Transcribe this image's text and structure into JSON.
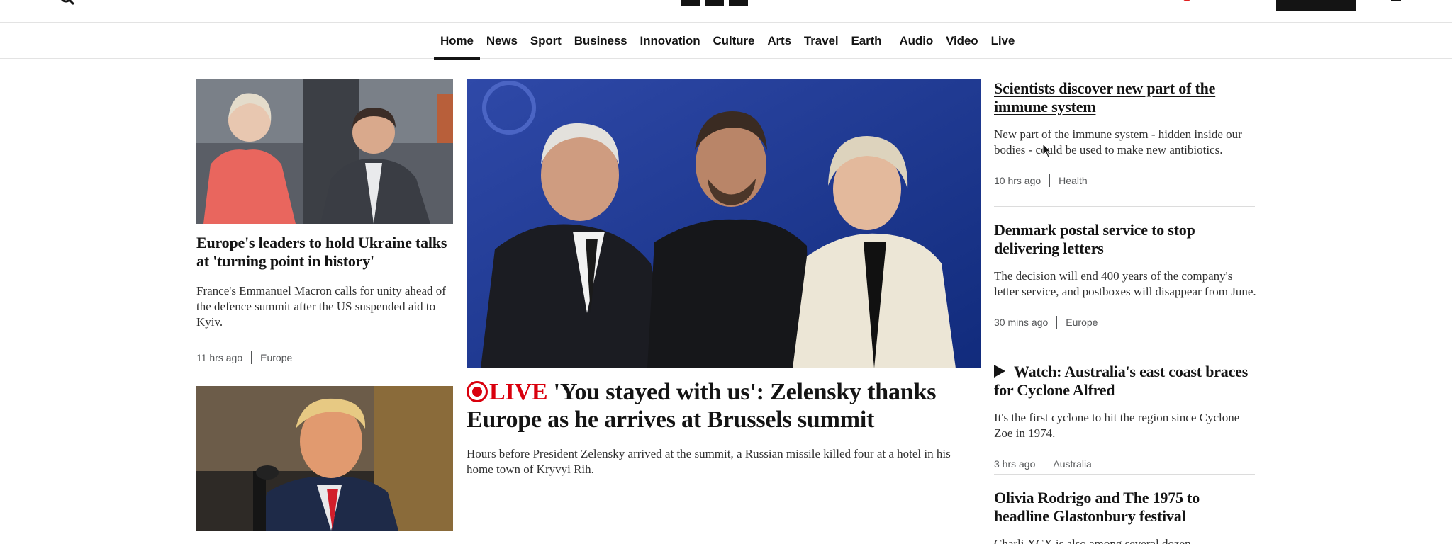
{
  "header": {
    "menu_icon": "hamburger-menu-icon",
    "search_icon": "search-icon",
    "logo": "bbc-logo"
  },
  "nav": {
    "items": [
      "Home",
      "News",
      "Sport",
      "Business",
      "Innovation",
      "Culture",
      "Arts",
      "Travel",
      "Earth",
      "Audio",
      "Video",
      "Live"
    ],
    "active": "Home"
  },
  "stories": {
    "europe_leaders": {
      "headline": "Europe's leaders to hold Ukraine talks at 'turning point in history'",
      "summary": "France's Emmanuel Macron calls for unity ahead of the defence summit after the US suspended aid to Kyiv.",
      "time": "11 hrs ago",
      "category": "Europe"
    },
    "zelensky_live": {
      "live_label": "LIVE",
      "headline": "'You stayed with us': Zelensky thanks Europe as he arrives at Brussels summit",
      "summary": "Hours before President Zelensky arrived at the summit, a Russian missile killed four at a hotel in his home town of Kryvyi Rih."
    },
    "immune_system": {
      "headline": "Scientists discover new part of the immune system",
      "summary": "New part of the immune system - hidden inside our bodies - could be used to make new antibiotics.",
      "time": "10 hrs ago",
      "category": "Health"
    },
    "denmark_post": {
      "headline": "Denmark postal service to stop delivering letters",
      "summary": "The decision will end 400 years of the company's letter service, and postboxes will disappear from June.",
      "time": "30 mins ago",
      "category": "Europe"
    },
    "cyclone_alfred": {
      "headline": "Watch: Australia's east coast braces for Cyclone Alfred",
      "summary": "It's the first cyclone to hit the region since Cyclone Zoe in 1974.",
      "time": "3 hrs ago",
      "category": "Australia"
    },
    "glastonbury": {
      "headline": "Olivia Rodrigo and The 1975 to headline Glastonbury festival",
      "summary": "Charli XCX is also among several dozen"
    }
  }
}
